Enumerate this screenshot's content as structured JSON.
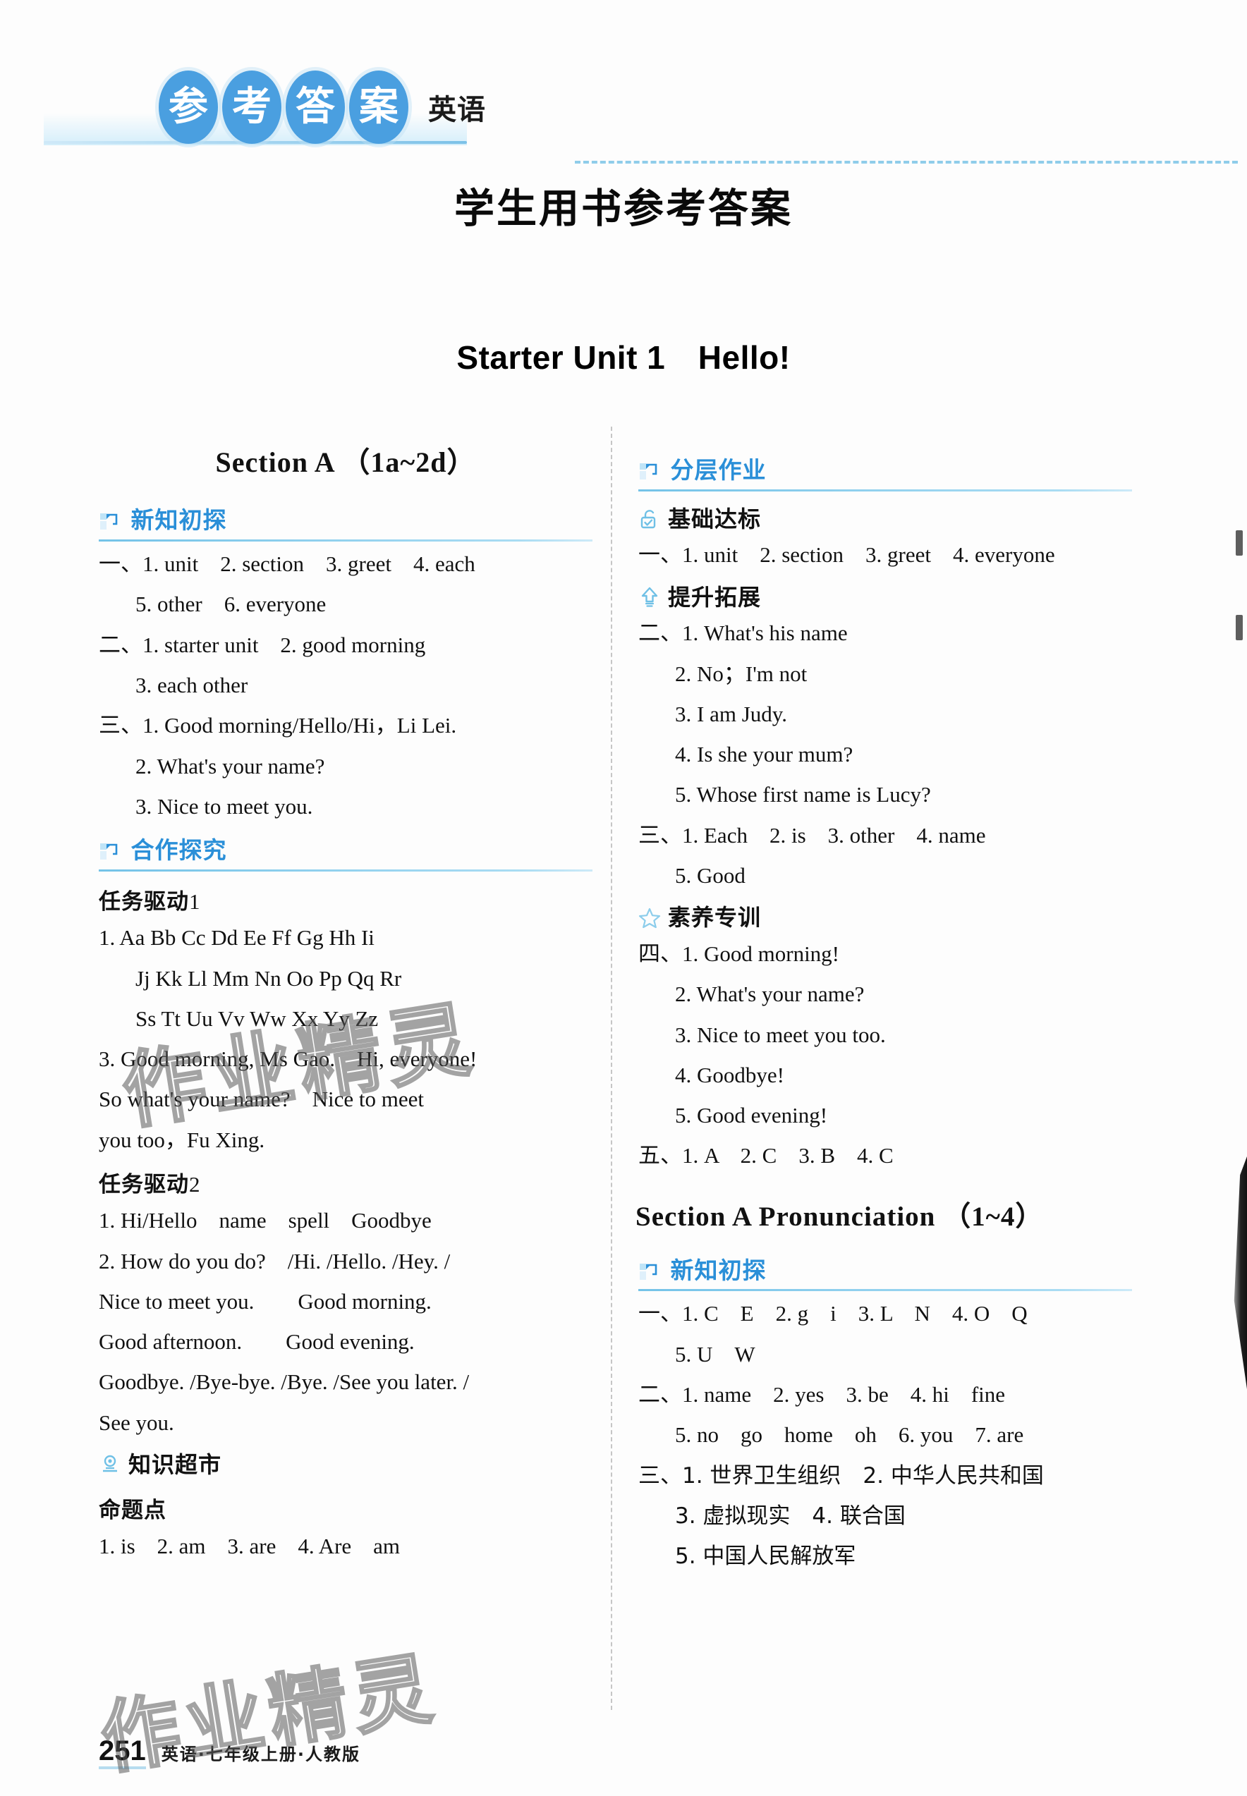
{
  "header": {
    "logo_chars": [
      "参",
      "考",
      "答",
      "案"
    ],
    "subject": "英语"
  },
  "page_title": "学生用书参考答案",
  "unit_title": "Starter Unit 1 Hello!",
  "left_column": {
    "section_head": "Section A （1a~2d）",
    "rubric_1": {
      "icon": "flag-icon",
      "label": "新知初探"
    },
    "answers_1": [
      "一、1. unit　2. section　3. greet　4. each",
      "5. other　6. everyone",
      "二、1. starter unit　2. good morning",
      "3. each other",
      "三、1. Good morning/Hello/Hi，Li Lei.",
      "2. What's your name?",
      "3. Nice to meet you."
    ],
    "answers_1_indent": [
      false,
      true,
      false,
      true,
      false,
      true,
      true
    ],
    "rubric_2": {
      "icon": "flag-icon",
      "label": "合作探究"
    },
    "task_1": {
      "zh": "任务驱动",
      "num": "1"
    },
    "answers_2": [
      "1. Aa Bb Cc Dd Ee Ff Gg Hh Ii",
      "Jj Kk Ll Mm Nn Oo Pp Qq Rr",
      "Ss Tt Uu Vv Ww Xx Yy Zz",
      "3. Good morning, Ms Gao.　Hi, everyone!",
      "So what's your name?　Nice to meet",
      "you too，Fu Xing."
    ],
    "answers_2_indent": [
      false,
      true,
      true,
      false,
      false,
      false
    ],
    "task_2": {
      "zh": "任务驱动",
      "num": "2"
    },
    "answers_3": [
      "1. Hi/Hello　name　spell　Goodbye",
      "2. How do you do?　/Hi. /Hello. /Hey. /",
      "Nice to meet you.　　Good morning.",
      "Good afternoon.　　Good evening.",
      "Goodbye. /Bye-bye. /Bye. /See you later. /",
      "See you."
    ],
    "answers_3_indent": [
      false,
      false,
      false,
      false,
      false,
      false
    ],
    "rubric_3": {
      "icon": "location-pin-icon",
      "label": "知识超市"
    },
    "sub_head": "命题点",
    "answers_4": [
      "1. is　2. am　3. are　4. Are　am"
    ]
  },
  "right_column": {
    "rubric_1": {
      "icon": "flag-icon",
      "label": "分层作业"
    },
    "sub_1": {
      "icon": "unlock-check-icon",
      "label": "基础达标"
    },
    "answers_1": [
      "一、1. unit　2. section　3. greet　4. everyone"
    ],
    "sub_2": {
      "icon": "up-arrow-icon",
      "label": "提升拓展"
    },
    "answers_2": [
      "二、1. What's his name",
      "2. No；I'm not",
      "3. I am Judy.",
      "4. Is she your mum?",
      "5. Whose first name is Lucy?",
      "三、1. Each　2. is　3. other　4. name",
      "5. Good"
    ],
    "answers_2_indent": [
      false,
      true,
      true,
      true,
      true,
      false,
      true
    ],
    "sub_3": {
      "icon": "star-icon",
      "label": "素养专训"
    },
    "answers_3": [
      "四、1. Good morning!",
      "2. What's your name?",
      "3. Nice to meet you too.",
      "4. Goodbye!",
      "5. Good evening!",
      "五、1. A　2. C　3. B　4. C"
    ],
    "answers_3_indent": [
      false,
      true,
      true,
      true,
      true,
      false
    ],
    "section_head": "Section A Pronunciation （1~4）",
    "rubric_2": {
      "icon": "flag-icon",
      "label": "新知初探"
    },
    "answers_4": [
      "一、1. C　E　2. g　i　3. L　N　4. O　Q",
      "5. U　W",
      "二、1. name　2. yes　3. be　4. hi　fine",
      "5. no　go　home　oh　6. you　7. are",
      "三、1. 世界卫生组织　2. 中华人民共和国",
      "3. 虚拟现实　4. 联合国",
      "5. 中国人民解放军"
    ],
    "answers_4_indent": [
      false,
      true,
      false,
      true,
      false,
      true,
      true
    ]
  },
  "footer": {
    "page_number": "251",
    "caption": "英语·七年级上册·人教版"
  },
  "watermark": "作业精灵",
  "colors": {
    "accent_blue": "#2a8fd8",
    "logo_blue": "#4a9fe0",
    "rule_blue": "#8fcdea",
    "page_bg": "#fdfdfd"
  }
}
